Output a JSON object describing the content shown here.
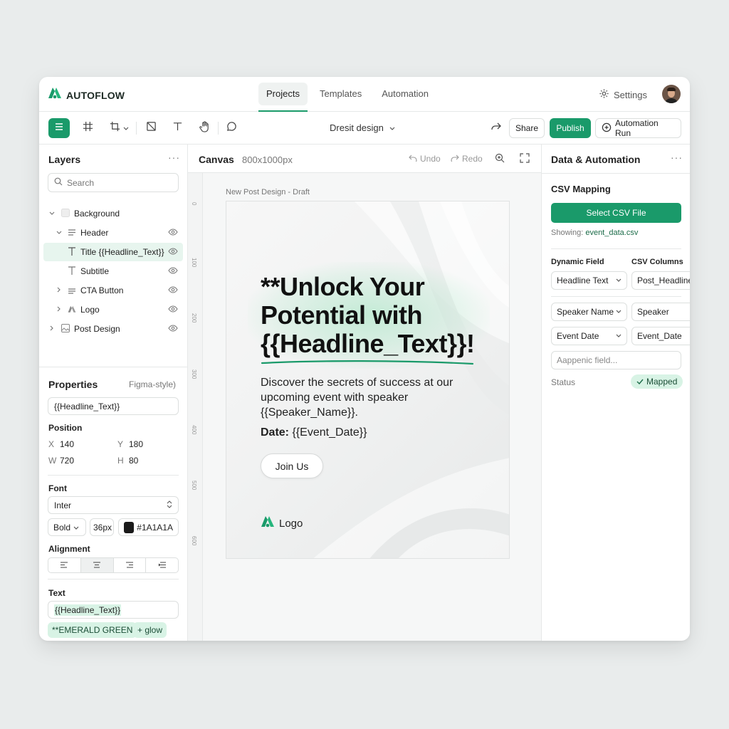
{
  "app": {
    "name": "AUTOFLOW"
  },
  "nav": {
    "tabs": [
      "Projects",
      "Templates",
      "Automation"
    ],
    "settings_label": "Settings"
  },
  "toolbar": {
    "doc_name": "Dresit design",
    "share_label": "Share",
    "publish_label": "Publish",
    "automation_run_label": "Automation Run"
  },
  "layers": {
    "title": "Layers",
    "search_placeholder": "Search",
    "items": [
      {
        "label": "Background"
      },
      {
        "label": "Header"
      },
      {
        "label": "Title {{Headline_Text}}"
      },
      {
        "label": "Subtitle"
      },
      {
        "label": "CTA Button"
      },
      {
        "label": "Logo"
      },
      {
        "label": "Post Design"
      }
    ]
  },
  "properties": {
    "title": "Properties",
    "hint": "Figma-style)",
    "name_value": "{{Headline_Text}}",
    "position_label": "Position",
    "x_label": "X",
    "x": "140",
    "y_label": "Y",
    "y": "180",
    "w_label": "W",
    "w": "720",
    "h_label": "H",
    "h": "80",
    "font_label": "Font",
    "font_family": "Inter",
    "font_weight": "Bold",
    "font_size": "36px",
    "font_color": "#1A1A1A",
    "alignment_label": "Alignment",
    "text_label": "Text",
    "text_value": "{{Headline_Text}}",
    "chip_color": "**EMERALD GREEN",
    "chip_effect": "+ glow"
  },
  "canvas": {
    "title": "Canvas",
    "size": "800x1000px",
    "undo_label": "Undo",
    "redo_label": "Redo",
    "draft_label": "New Post Design - Draft",
    "ruler": [
      "0",
      "100",
      "200",
      "300",
      "400",
      "500",
      "600"
    ],
    "headline": "**Unlock Your Potential with {{Headline_Text}}!",
    "subcopy": "Discover the secrets of success at our upcoming event with speaker {{Speaker_Name}}.",
    "date_label": "Date:",
    "date_value": " {{Event_Date}}",
    "cta_label": "Join Us",
    "logo_label": "Logo"
  },
  "data_panel": {
    "title": "Data & Automation",
    "csv_mapping_label": "CSV Mapping",
    "select_csv_label": "Select CSV File",
    "showing_label": "Showing:",
    "showing_file": "event_data.csv",
    "dynamic_field_label": "Dynamic Field",
    "csv_columns_label": "CSV Columns",
    "mappings": [
      {
        "field": "Headline Text",
        "column": "Post_Headline"
      },
      {
        "field": "Speaker Name",
        "column": "Speaker"
      },
      {
        "field": "Event Date",
        "column": "Event_Date"
      }
    ],
    "append_placeholder": "Aappenic field...",
    "status_label": "Status",
    "status_value": "Mapped"
  },
  "colors": {
    "accent": "#1a9a6a",
    "accent_soft": "#d8f3e5",
    "selected_row": "#e7f5ee"
  }
}
